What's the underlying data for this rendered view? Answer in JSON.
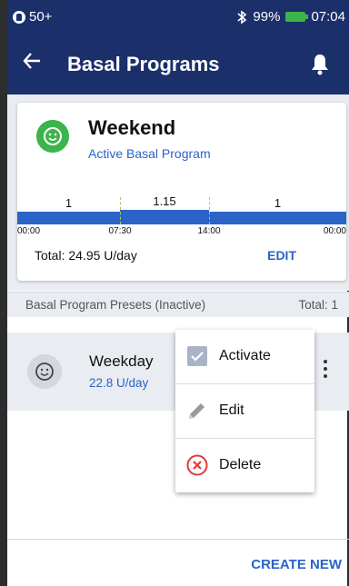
{
  "status_bar": {
    "pod_status": "50+",
    "bluetooth_icon": "bluetooth-icon",
    "battery_percent": "99%",
    "battery_icon": "battery-charging-icon",
    "time": "07:04"
  },
  "app_bar": {
    "back_icon": "arrow-left-icon",
    "title": "Basal Programs",
    "notification_icon": "bell-icon"
  },
  "active_program": {
    "icon": "smiley-icon",
    "name": "Weekend",
    "status": "Active Basal Program",
    "total": "Total: 24.95 U/day",
    "edit_label": "EDIT"
  },
  "chart_data": {
    "type": "step",
    "segments": [
      {
        "start": "00:00",
        "end": "07:30",
        "rate": 1,
        "label": "1"
      },
      {
        "start": "07:30",
        "end": "14:00",
        "rate": 1.15,
        "label": "1.15"
      },
      {
        "start": "14:00",
        "end": "24:00",
        "rate": 1,
        "label": "1"
      }
    ],
    "x_ticks": [
      "00:00",
      "07:30",
      "14:00",
      "00:00"
    ],
    "color": "#2a64c8"
  },
  "presets": {
    "header_label": "Basal Program Presets (Inactive)",
    "total_label": "Total: 1",
    "items": [
      {
        "icon": "smiley-icon",
        "name": "Weekday",
        "rate": "22.8 U/day",
        "menu_icon": "more-vert-icon"
      }
    ]
  },
  "context_menu": {
    "items": [
      {
        "label": "Activate",
        "icon": "checkbox-icon"
      },
      {
        "label": "Edit",
        "icon": "pencil-icon"
      },
      {
        "label": "Delete",
        "icon": "delete-circle-icon"
      }
    ]
  },
  "footer": {
    "create_new_label": "CREATE NEW"
  },
  "colors": {
    "header_bg": "#1b2f6b",
    "accent_blue": "#2a64c8",
    "active_green": "#3bb54a",
    "delete_red": "#e53935"
  }
}
